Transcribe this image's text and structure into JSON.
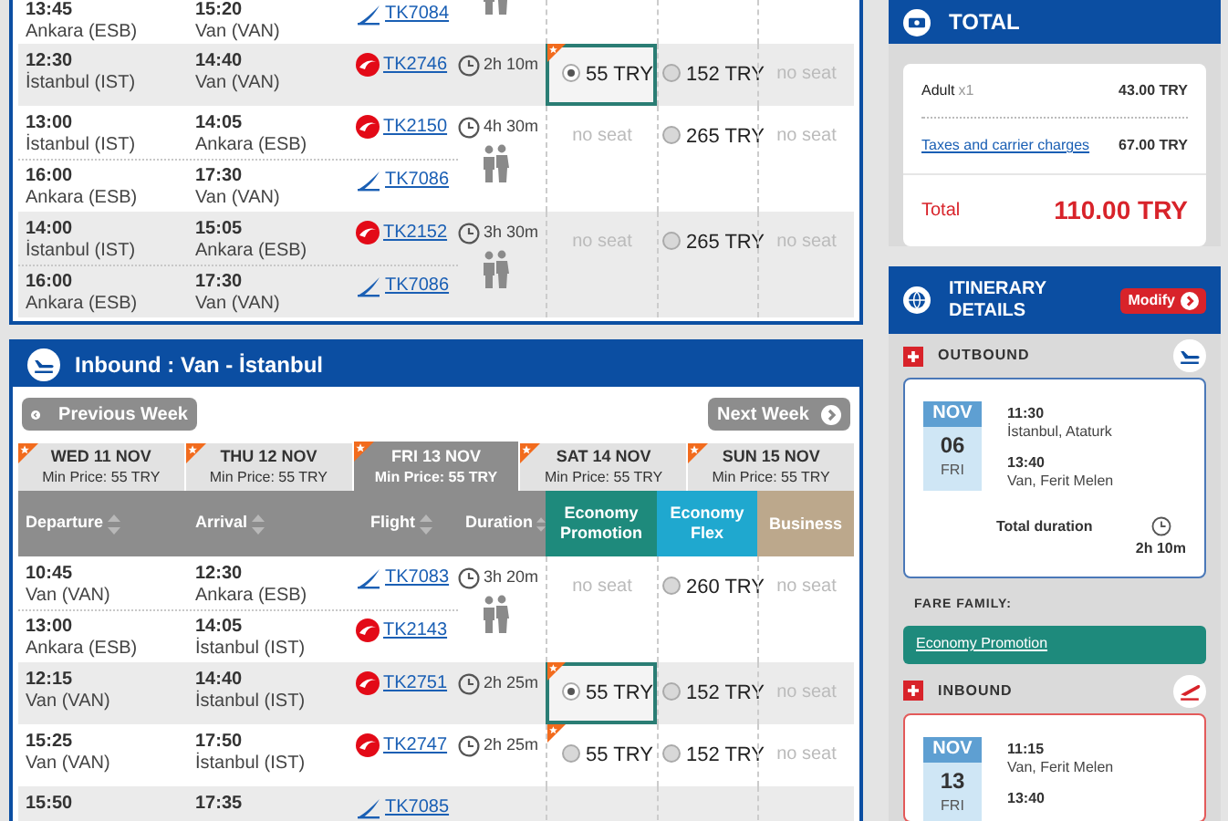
{
  "outbound": {
    "rows": [
      {
        "legs": [
          {
            "dep_time": "13:45",
            "dep_airport": "Ankara (ESB)",
            "arr_time": "15:20",
            "arr_airport": "Van (VAN)",
            "flight": "TK7084",
            "kind": "swoosh"
          }
        ],
        "connecting": true
      },
      {
        "legs": [
          {
            "dep_time": "12:30",
            "dep_airport": "İstanbul (IST)",
            "arr_time": "14:40",
            "arr_airport": "Van (VAN)",
            "flight": "TK2746",
            "kind": "circle"
          }
        ],
        "duration": "2h 10m",
        "connecting": false,
        "fares": [
          {
            "kind": "price",
            "text": "55 TRY",
            "selected": true,
            "promo": true
          },
          {
            "kind": "price",
            "text": "152 TRY",
            "selected": false,
            "promo": false
          },
          {
            "kind": "none",
            "text": "no seat"
          }
        ]
      },
      {
        "legs": [
          {
            "dep_time": "13:00",
            "dep_airport": "İstanbul (IST)",
            "arr_time": "14:05",
            "arr_airport": "Ankara (ESB)",
            "flight": "TK2150",
            "kind": "circle"
          },
          {
            "dep_time": "16:00",
            "dep_airport": "Ankara (ESB)",
            "arr_time": "17:30",
            "arr_airport": "Van (VAN)",
            "flight": "TK7086",
            "kind": "swoosh"
          }
        ],
        "duration": "4h 30m",
        "connecting": true,
        "fares": [
          {
            "kind": "none",
            "text": "no seat"
          },
          {
            "kind": "price",
            "text": "265 TRY",
            "selected": false,
            "promo": false
          },
          {
            "kind": "none",
            "text": "no seat"
          }
        ]
      },
      {
        "legs": [
          {
            "dep_time": "14:00",
            "dep_airport": "İstanbul (IST)",
            "arr_time": "15:05",
            "arr_airport": "Ankara (ESB)",
            "flight": "TK2152",
            "kind": "circle"
          },
          {
            "dep_time": "16:00",
            "dep_airport": "Ankara (ESB)",
            "arr_time": "17:30",
            "arr_airport": "Van (VAN)",
            "flight": "TK7086",
            "kind": "swoosh"
          }
        ],
        "duration": "3h 30m",
        "connecting": true,
        "fares": [
          {
            "kind": "none",
            "text": "no seat"
          },
          {
            "kind": "price",
            "text": "265 TRY",
            "selected": false,
            "promo": false
          },
          {
            "kind": "none",
            "text": "no seat"
          }
        ]
      }
    ]
  },
  "inbound": {
    "title": "Inbound : Van - İstanbul",
    "prev_button": "Previous Week",
    "next_button": "Next Week",
    "date_tabs": [
      {
        "day": "WED 11 NOV",
        "min_price": "Min Price: 55 TRY",
        "selected": false
      },
      {
        "day": "THU 12 NOV",
        "min_price": "Min Price: 55 TRY",
        "selected": false
      },
      {
        "day": "FRI 13 NOV",
        "min_price": "Min Price: 55 TRY",
        "selected": true
      },
      {
        "day": "SAT 14 NOV",
        "min_price": "Min Price: 55 TRY",
        "selected": false
      },
      {
        "day": "SUN 15 NOV",
        "min_price": "Min Price: 55 TRY",
        "selected": false
      }
    ],
    "columns": [
      {
        "label": "Departure",
        "kind": "sort"
      },
      {
        "label": "Arrival",
        "kind": "sort"
      },
      {
        "label": "Flight",
        "kind": "sort"
      },
      {
        "label": "Duration",
        "kind": "sort"
      },
      {
        "label": "Economy Promotion",
        "kind": "fare",
        "color": "#1e8a7c"
      },
      {
        "label": "Economy Flex",
        "kind": "fare",
        "color": "#1fa8cf"
      },
      {
        "label": "Business",
        "kind": "fare",
        "color": "#bca88c"
      }
    ],
    "rows": [
      {
        "legs": [
          {
            "dep_time": "10:45",
            "dep_airport": "Van (VAN)",
            "arr_time": "12:30",
            "arr_airport": "Ankara (ESB)",
            "flight": "TK7083",
            "kind": "swoosh"
          },
          {
            "dep_time": "13:00",
            "dep_airport": "Ankara (ESB)",
            "arr_time": "14:05",
            "arr_airport": "İstanbul (IST)",
            "flight": "TK2143",
            "kind": "circle"
          }
        ],
        "duration": "3h 20m",
        "connecting": true,
        "fares": [
          {
            "kind": "none",
            "text": "no seat"
          },
          {
            "kind": "price",
            "text": "260 TRY",
            "selected": false,
            "promo": false
          },
          {
            "kind": "none",
            "text": "no seat"
          }
        ]
      },
      {
        "legs": [
          {
            "dep_time": "12:15",
            "dep_airport": "Van (VAN)",
            "arr_time": "14:40",
            "arr_airport": "İstanbul (IST)",
            "flight": "TK2751",
            "kind": "circle"
          }
        ],
        "duration": "2h 25m",
        "connecting": false,
        "fares": [
          {
            "kind": "price",
            "text": "55 TRY",
            "selected": true,
            "promo": true
          },
          {
            "kind": "price",
            "text": "152 TRY",
            "selected": false,
            "promo": false
          },
          {
            "kind": "none",
            "text": "no seat"
          }
        ]
      },
      {
        "legs": [
          {
            "dep_time": "15:25",
            "dep_airport": "Van (VAN)",
            "arr_time": "17:50",
            "arr_airport": "İstanbul (IST)",
            "flight": "TK2747",
            "kind": "circle"
          }
        ],
        "duration": "2h 25m",
        "connecting": false,
        "fares": [
          {
            "kind": "price",
            "text": "55 TRY",
            "selected": false,
            "promo": true
          },
          {
            "kind": "price",
            "text": "152 TRY",
            "selected": false,
            "promo": false
          },
          {
            "kind": "none",
            "text": "no seat"
          }
        ]
      },
      {
        "legs": [
          {
            "dep_time": "15:50",
            "arr_time": "17:35",
            "flight": "TK7085",
            "kind": "swoosh"
          }
        ]
      }
    ]
  },
  "total": {
    "title": "TOTAL",
    "lines": [
      {
        "label": "Adult",
        "qty": "x1",
        "amount": "43.00 TRY",
        "kind": "plain"
      },
      {
        "label": "Taxes and carrier charges",
        "amount": "67.00 TRY",
        "kind": "link"
      }
    ],
    "total_label": "Total",
    "total_amount": "110.00 TRY"
  },
  "itinerary": {
    "title": "ITINERARY DETAILS",
    "modify_button": "Modify",
    "outbound": {
      "label": "OUTBOUND",
      "month": "NOV",
      "day": "06",
      "weekday": "FRI",
      "dep_time": "11:30",
      "dep_place": "İstanbul, Ataturk",
      "arr_time": "13:40",
      "arr_place": "Van, Ferit Melen",
      "duration_label": "Total duration",
      "duration": "2h 10m"
    },
    "fare_family_label": "FARE FAMILY:",
    "fare_family": "Economy Promotion",
    "inbound": {
      "label": "INBOUND",
      "month": "NOV",
      "day": "13",
      "weekday": "FRI",
      "dep_time": "11:15",
      "dep_place": "Van, Ferit Melen",
      "arr_time": "13:40"
    }
  }
}
